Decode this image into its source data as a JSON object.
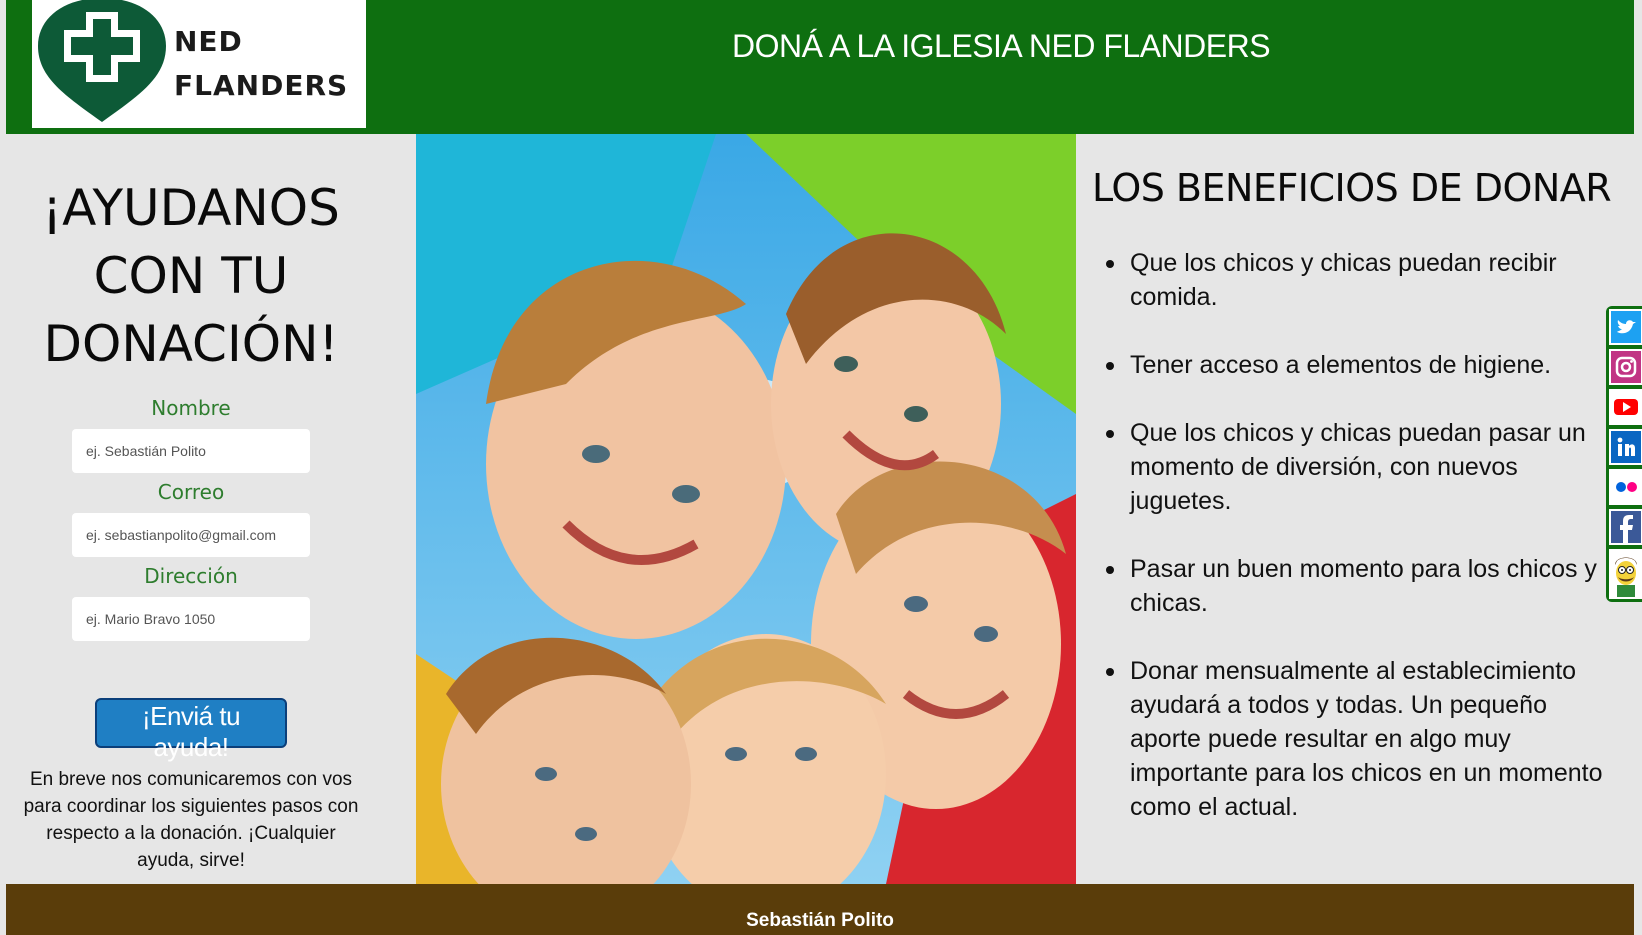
{
  "header": {
    "logo_line1": "NED",
    "logo_line2": "FLANDERS",
    "title": "DONÁ A LA IGLESIA NED FLANDERS"
  },
  "form": {
    "heading": "¡AYUDANOS CON TU DONACIÓN!",
    "fields": [
      {
        "label": "Nombre",
        "placeholder": "ej. Sebastián Polito",
        "value": ""
      },
      {
        "label": "Correo",
        "placeholder": "ej. sebastianpolito@gmail.com",
        "value": ""
      },
      {
        "label": "Dirección",
        "placeholder": "ej. Mario Bravo 1050",
        "value": ""
      }
    ],
    "submit_label": "¡Enviá tu ayuda!",
    "note": "En breve nos comunicaremos con vos para coordinar los siguientes pasos con respecto a la donación. ¡Cualquier ayuda, sirve!"
  },
  "benefits": {
    "title": "LOS BENEFICIOS DE DONAR",
    "items": [
      "Que los chicos y chicas puedan recibir comida.",
      "Tener acceso a elementos de higiene.",
      "Que los chicos y chicas puedan pasar un momento de diversión, con nuevos juguetes.",
      "Pasar un buen momento para los chicos y chicas.",
      "Donar mensualmente al establecimiento ayudará a todos y todas. Un pequeño aporte puede resultar en algo muy importante para los chicos en un momento como el actual."
    ]
  },
  "social": [
    "twitter-icon",
    "instagram-icon",
    "youtube-icon",
    "linkedin-icon",
    "flickr-icon",
    "facebook-icon",
    "ned-flanders-icon"
  ],
  "footer": {
    "author": "Sebastián Polito"
  },
  "colors": {
    "header_bg": "#0e6f10",
    "footer_bg": "#5a3d0a",
    "button_bg": "#1f7fc4",
    "label_green": "#2e7d2e",
    "page_bg": "#e6e6e6"
  }
}
